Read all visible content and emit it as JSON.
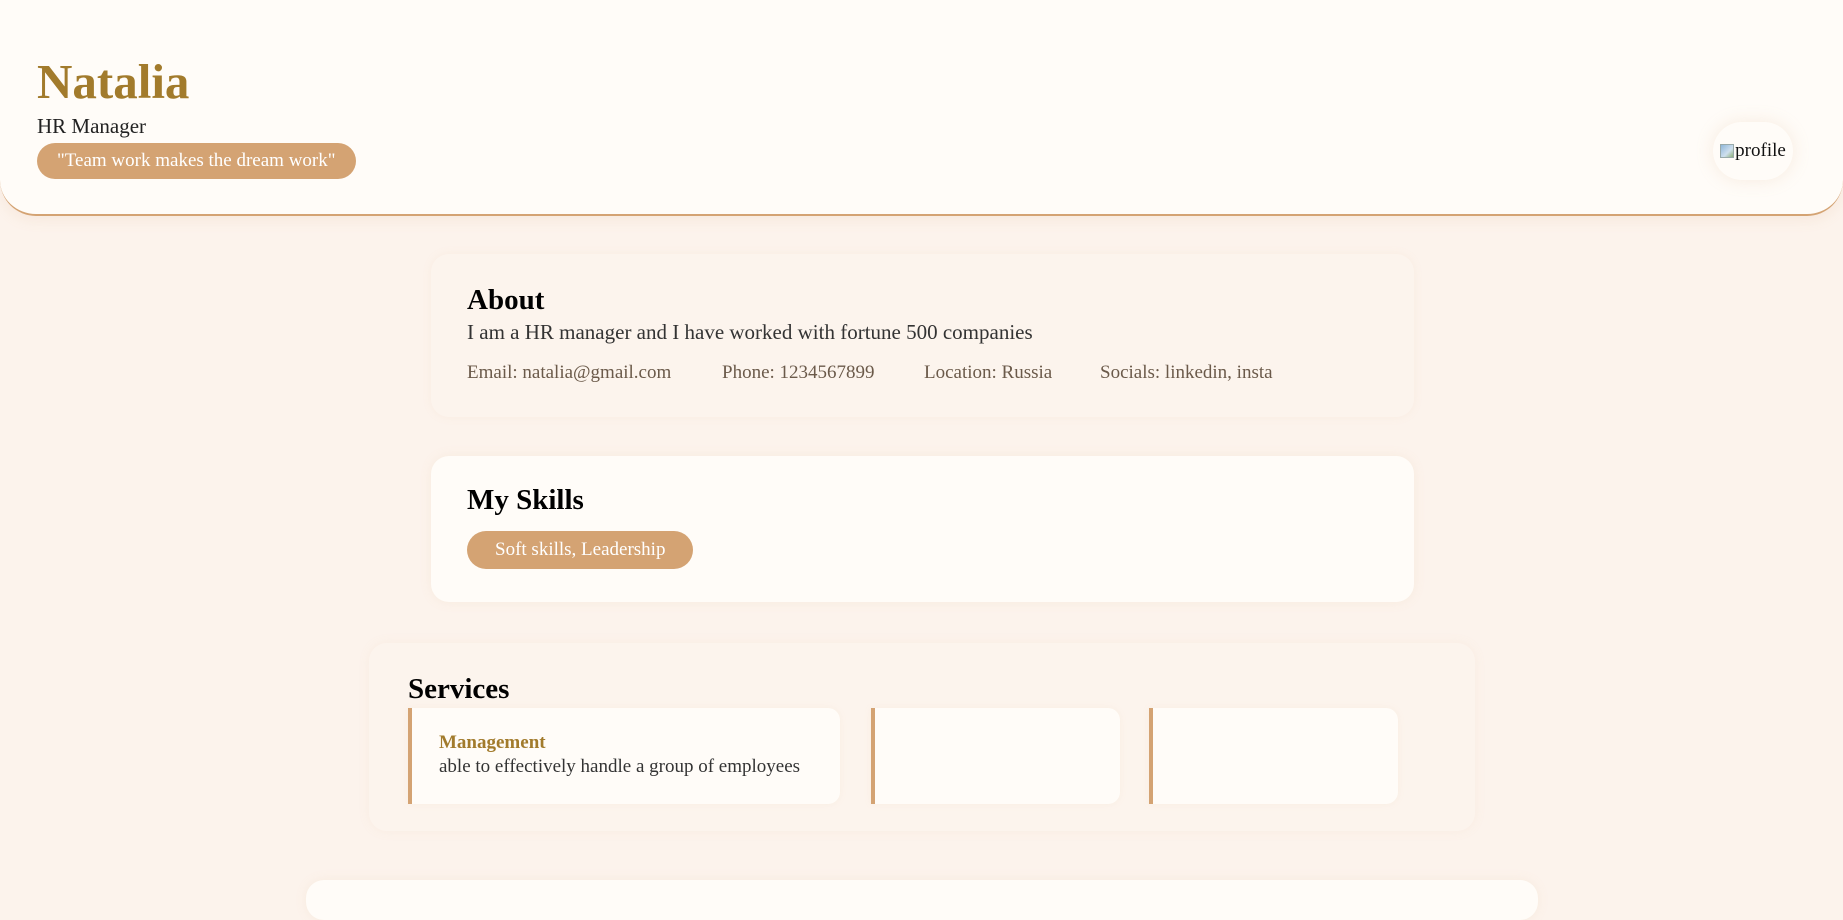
{
  "header": {
    "name": "Natalia",
    "role": "HR Manager",
    "quote": "\"Team work makes the dream work\"",
    "profile_alt": "profile"
  },
  "about": {
    "title": "About",
    "text": "I am a HR manager and I have worked with fortune 500 companies",
    "email": "Email: natalia@gmail.com",
    "phone": "Phone: 1234567899",
    "location": "Location: Russia",
    "socials": "Socials: linkedin, insta"
  },
  "skills": {
    "title": "My Skills",
    "items": [
      "Soft skills, Leadership"
    ]
  },
  "services": {
    "title": "Services",
    "items": [
      {
        "name": "Management",
        "description": "able to effectively handle a group of employees"
      },
      {
        "name": "",
        "description": ""
      },
      {
        "name": "",
        "description": ""
      }
    ]
  },
  "colors": {
    "accent": "#d4a373",
    "heading": "#a27b2c",
    "background": "#fcf3ec",
    "card": "#fffcf8"
  }
}
